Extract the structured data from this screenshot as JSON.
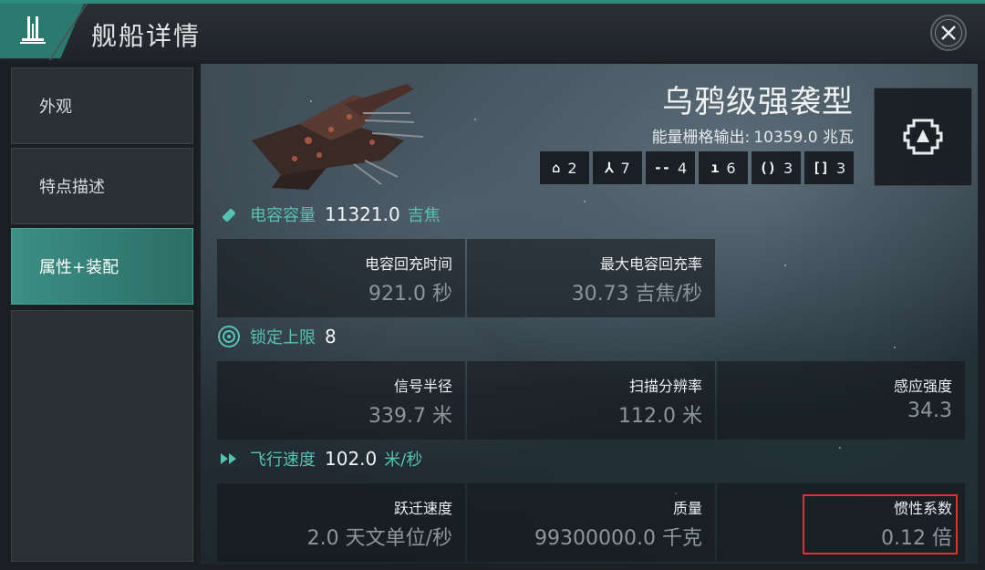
{
  "header": {
    "title": "舰船详情"
  },
  "sidebar": {
    "items": [
      {
        "label": "外观"
      },
      {
        "label": "特点描述"
      },
      {
        "label": "属性+装配"
      }
    ]
  },
  "ship": {
    "name": "乌鸦级强袭型",
    "power_label": "能量栅格输出:",
    "power_value": "10359.0 兆瓦",
    "slots": [
      {
        "icon": "drone-icon",
        "glyph": "⌂",
        "count": "2"
      },
      {
        "icon": "turret-icon",
        "glyph": "⅄",
        "count": "7"
      },
      {
        "icon": "launcher-icon",
        "glyph": "--",
        "count": "4"
      },
      {
        "icon": "high-slot-icon",
        "glyph": "ı",
        "count": "6"
      },
      {
        "icon": "mid-slot-icon",
        "glyph": "()",
        "count": "3"
      },
      {
        "icon": "low-slot-icon",
        "glyph": "[]",
        "count": "3"
      }
    ]
  },
  "capacitor": {
    "label": "电容容量",
    "value": "11321.0",
    "unit": "吉焦",
    "cells": [
      {
        "label": "电容回充时间",
        "value": "921.0 秒"
      },
      {
        "label": "最大电容回充率",
        "value": "30.73 吉焦/秒"
      }
    ]
  },
  "targeting": {
    "label": "锁定上限",
    "value": "8",
    "cells": [
      {
        "label": "信号半径",
        "value": "339.7 米"
      },
      {
        "label": "扫描分辨率",
        "value": "112.0 米"
      },
      {
        "label": "感应强度",
        "value": "34.3"
      }
    ]
  },
  "speed": {
    "label": "飞行速度",
    "value": "102.0",
    "unit": "米/秒",
    "cells": [
      {
        "label": "跃迁速度",
        "value": "2.0 天文单位/秒"
      },
      {
        "label": "质量",
        "value": "99300000.0 千克"
      },
      {
        "label": "惯性系数",
        "value": "0.12 倍"
      }
    ]
  },
  "colors": {
    "accent": "#56c3b2",
    "active_tab": "#3b8f84",
    "highlight": "#e0312e"
  }
}
